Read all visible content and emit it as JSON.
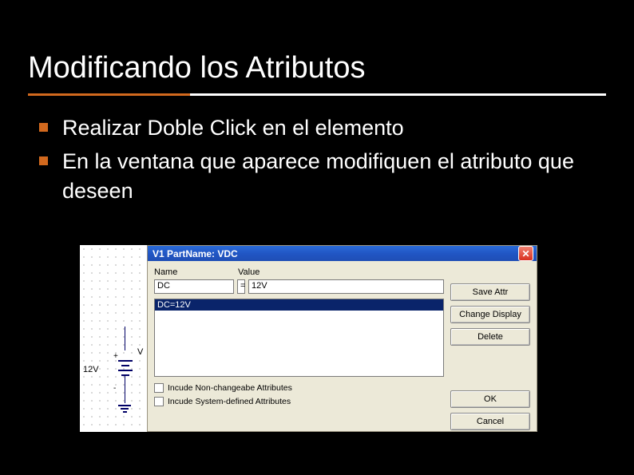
{
  "title": "Modificando los Atributos",
  "bullets": [
    "Realizar Doble Click en el elemento",
    "En la ventana que aparece modifiquen el atributo que deseen"
  ],
  "schematic": {
    "component_label": "V",
    "value_label": "12V",
    "plus": "+",
    "minus": "-"
  },
  "dialog": {
    "title": "V1  PartName: VDC",
    "labels": {
      "name": "Name",
      "value": "Value"
    },
    "fields": {
      "name": "DC",
      "eq": "=",
      "value": "12V"
    },
    "list_selected": "DC=12V",
    "checkboxes": {
      "nonchangeable": "Incude Non-changeabe Attributes",
      "systemdefined": "Incude System-defined Attributes"
    },
    "buttons": {
      "save": "Save Attr",
      "change": "Change Display",
      "delete": "Delete",
      "ok": "OK",
      "cancel": "Cancel"
    }
  }
}
